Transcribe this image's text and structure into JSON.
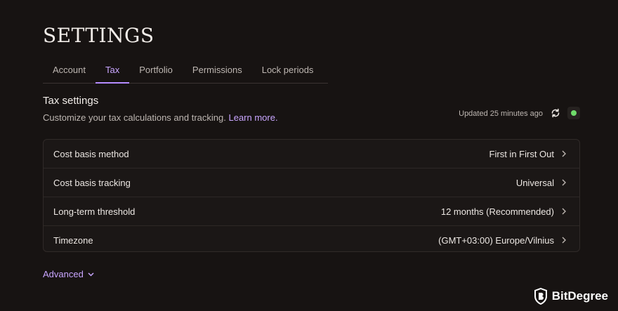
{
  "page": {
    "title": "SETTINGS"
  },
  "tabs": [
    {
      "label": "Account"
    },
    {
      "label": "Tax"
    },
    {
      "label": "Portfolio"
    },
    {
      "label": "Permissions"
    },
    {
      "label": "Lock periods"
    }
  ],
  "active_tab": "Tax",
  "section": {
    "title": "Tax settings",
    "subtitle": "Customize your tax calculations and tracking.",
    "link": "Learn more."
  },
  "status": {
    "updated_text": "Updated 25 minutes ago",
    "status_color": "#6fdc6a"
  },
  "settings": [
    {
      "label": "Cost basis method",
      "value": "First in First Out"
    },
    {
      "label": "Cost basis tracking",
      "value": "Universal"
    },
    {
      "label": "Long-term threshold",
      "value": "12 months (Recommended)"
    },
    {
      "label": "Timezone",
      "value": "(GMT+03:00) Europe/Vilnius"
    }
  ],
  "advanced_label": "Advanced",
  "brand": {
    "name": "BitDegree"
  },
  "colors": {
    "accent": "#b58cff",
    "background": "#171312"
  }
}
